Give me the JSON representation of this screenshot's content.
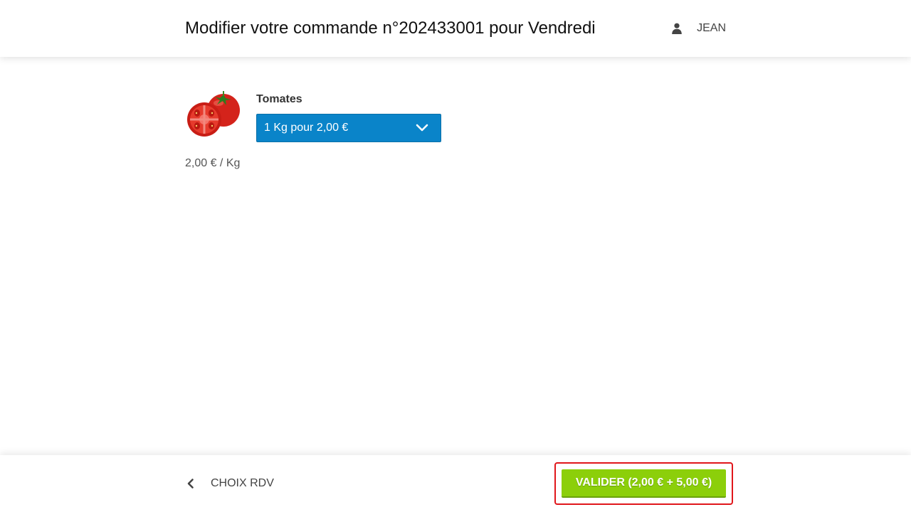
{
  "header": {
    "title": "Modifier votre commande n°202433001 pour Vendredi",
    "user": {
      "icon": "user-icon",
      "name": "JEAN"
    }
  },
  "product": {
    "name": "Tomates",
    "image": "tomato-image",
    "quantity_select": {
      "selected": "1 Kg pour 2,00 €",
      "icon": "chevron-down-icon",
      "color": "#0a84c9"
    },
    "unit_price": "2,00 € / Kg"
  },
  "footer": {
    "back": {
      "icon": "chevron-left-icon",
      "label": "CHOIX RDV"
    },
    "validate": {
      "label": "VALIDER (2,00 € + 5,00 €)",
      "color": "#8ccf0a",
      "highlight_color": "#e0161b"
    }
  }
}
